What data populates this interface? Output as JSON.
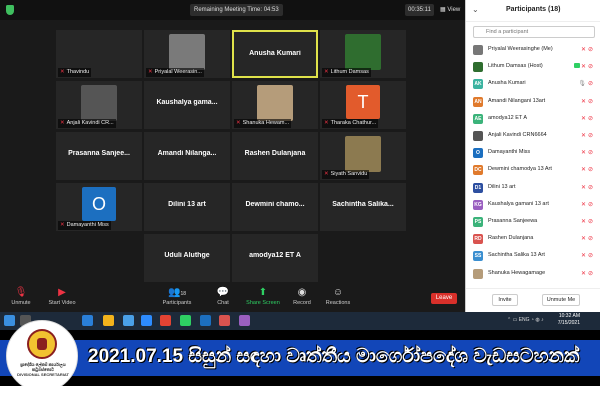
{
  "meeting": {
    "time_label": "Remaining Meeting Time: 04:53",
    "clock": "00:35:11",
    "view_label": "View"
  },
  "tiles": [
    {
      "name": "",
      "label": "Thavindu",
      "type": "blank"
    },
    {
      "name": "",
      "label": "Priyalal Weerasin...",
      "type": "photo",
      "color": "#7a7a7a"
    },
    {
      "name": "Anusha Kumari",
      "label": "",
      "type": "name",
      "active": true
    },
    {
      "name": "",
      "label": "Lithum Damsas",
      "type": "photo",
      "color": "#2f6d2f"
    },
    {
      "name": "",
      "label": "Anjali Kavindi CR...",
      "type": "photo",
      "color": "#555"
    },
    {
      "name": "Kaushalya gama...",
      "label": "",
      "type": "name"
    },
    {
      "name": "",
      "label": "Shanuka Hewam...",
      "type": "photo",
      "color": "#b59c7a"
    },
    {
      "name": "",
      "label": "Tharaka Chathur...",
      "type": "avatar",
      "letter": "T",
      "color": "#e25b2c"
    },
    {
      "name": "Prasanna Sanjee...",
      "label": "",
      "type": "name"
    },
    {
      "name": "Amandi Nilanga...",
      "label": "",
      "type": "name"
    },
    {
      "name": "Rashen Dulanjana",
      "label": "",
      "type": "name"
    },
    {
      "name": "",
      "label": "Siyath Sanvidu",
      "type": "photo",
      "color": "#8c7a50"
    },
    {
      "name": "",
      "label": "Damayanthi Miss",
      "type": "avatar",
      "letter": "O",
      "color": "#1c6fc0"
    },
    {
      "name": "Dilini 13 art",
      "label": "",
      "type": "name"
    },
    {
      "name": "Dewmini chamo...",
      "label": "",
      "type": "name"
    },
    {
      "name": "Sachintha Salika...",
      "label": "",
      "type": "name"
    },
    {
      "name": "Uduli Aluthge",
      "label": "",
      "type": "name"
    },
    {
      "name": "amodya12 ET A",
      "label": "",
      "type": "name"
    }
  ],
  "controls": {
    "unmute": "Unmute",
    "start_video": "Start Video",
    "participants": "Participants",
    "participants_count": "18",
    "chat": "Chat",
    "share_screen": "Share Screen",
    "record": "Record",
    "reactions": "Reactions",
    "leave": "Leave"
  },
  "panel": {
    "title": "Participants (18)",
    "search_placeholder": "Find a participant",
    "invite": "Invite",
    "unmute_me": "Unmute Me",
    "participants": [
      {
        "initials": "",
        "name": "Priyalal Weerasinghe (Me)",
        "color": "#777"
      },
      {
        "initials": "",
        "name": "Lithum Damsas (Host)",
        "color": "#2f6d2f",
        "host": true
      },
      {
        "initials": "AK",
        "name": "Anusha Kumari",
        "color": "#3bb3a0",
        "mic_on": true
      },
      {
        "initials": "AN",
        "name": "Amandi Nilangani 13art",
        "color": "#e07a2c"
      },
      {
        "initials": "AE",
        "name": "amodya12 ET A",
        "color": "#3bb37a"
      },
      {
        "initials": "",
        "name": "Anjali Kavindi CRN6664",
        "color": "#555"
      },
      {
        "initials": "O",
        "name": "Damayanthi Miss",
        "color": "#1c6fc0"
      },
      {
        "initials": "DC",
        "name": "Dewmini chamodya 13 Art",
        "color": "#e07a2c"
      },
      {
        "initials": "D1",
        "name": "Dilini 13 art",
        "color": "#2d4fa0"
      },
      {
        "initials": "KG",
        "name": "Kaushalya gamani  13 art",
        "color": "#9a5fc0"
      },
      {
        "initials": "PS",
        "name": "Prasanna Sanjeewa",
        "color": "#3bb37a"
      },
      {
        "initials": "RD",
        "name": "Rashen Dulanjana",
        "color": "#d9534f"
      },
      {
        "initials": "SS",
        "name": "Sachintha Salika 13 Art",
        "color": "#3b8fd0"
      },
      {
        "initials": "",
        "name": "Shanuka Hewagamage",
        "color": "#b59c7a"
      }
    ]
  },
  "taskbar": {
    "lang": "ENG",
    "time": "10:32 AM",
    "date": "7/15/2021"
  },
  "banner": {
    "text": "2021.07.15 සිසුන් සඳහා වෘත්තීය මාර්ගෝපදේශ වැඩසටහනක්",
    "logo_text": "ප්‍රාදේශීය ලේකම් කාර්යාලය\nකටුගස්තොට\nDIVISIONAL SECRETARIAT"
  }
}
